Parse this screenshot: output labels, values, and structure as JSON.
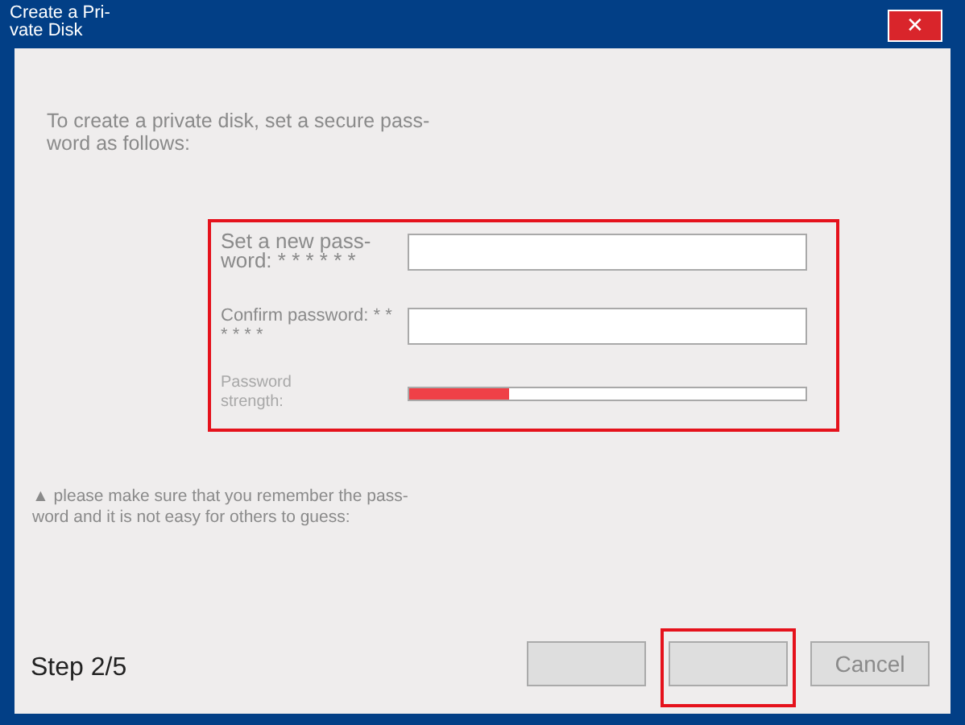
{
  "window": {
    "title_lines": [
      "Create a Pri-",
      "vate Disk"
    ],
    "close": "✕"
  },
  "intro": {
    "lines": [
      "To create a private disk, set a secure pass-",
      "word as follows:"
    ]
  },
  "form": {
    "highlighted": true,
    "fields": [
      {
        "kind": "input",
        "label_lines": [
          "Set a new pass-",
          "word: * * * * * *"
        ]
      },
      {
        "kind": "input",
        "label_lines": [
          "Confirm password: * *",
          "* * * *"
        ]
      },
      {
        "kind": "meter",
        "label_lines": [
          "Password",
          "strength:"
        ],
        "level": 0.25
      }
    ]
  },
  "note": {
    "lines": [
      "▲ please make sure that you remember the pass-",
      "word and it is not easy for others to guess:"
    ]
  },
  "footer": {
    "step": "Step 2/5",
    "buttons": [
      {
        "highlighted": false
      },
      {
        "highlighted": true
      },
      {
        "label": "Cancel",
        "highlighted": false
      }
    ]
  }
}
